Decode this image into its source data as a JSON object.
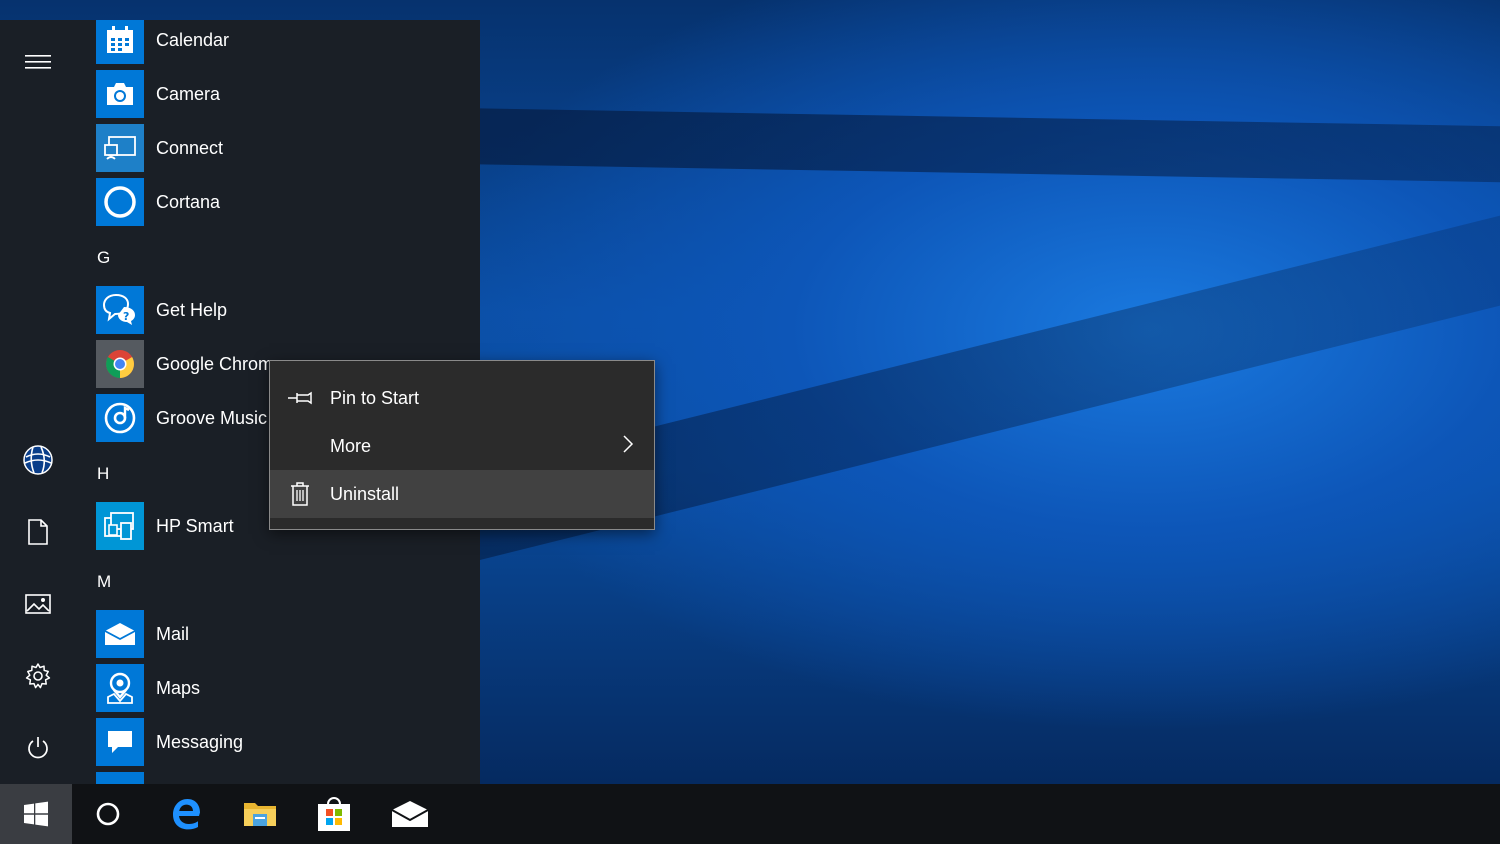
{
  "start_menu": {
    "rail": {
      "items": [
        {
          "name": "expand",
          "icon": "hamburger-icon"
        },
        {
          "name": "account",
          "icon": "user-avatar"
        },
        {
          "name": "documents",
          "icon": "document-icon"
        },
        {
          "name": "pictures",
          "icon": "pictures-icon"
        },
        {
          "name": "settings",
          "icon": "gear-icon"
        },
        {
          "name": "power",
          "icon": "power-icon"
        }
      ]
    },
    "app_list": {
      "apps": [
        {
          "label": "Calendar",
          "icon": "calendar-icon"
        },
        {
          "label": "Camera",
          "icon": "camera-icon"
        },
        {
          "label": "Connect",
          "icon": "connect-icon"
        },
        {
          "label": "Cortana",
          "icon": "cortana-icon"
        },
        {
          "label": "Get Help",
          "icon": "get-help-icon"
        },
        {
          "label": "Google Chrome",
          "icon": "chrome-icon"
        },
        {
          "label": "Groove Music",
          "icon": "groove-music-icon"
        },
        {
          "label": "HP Smart",
          "icon": "hp-smart-icon"
        },
        {
          "label": "Mail",
          "icon": "mail-icon"
        },
        {
          "label": "Maps",
          "icon": "maps-icon"
        },
        {
          "label": "Messaging",
          "icon": "messaging-icon"
        }
      ],
      "letters": [
        "G",
        "H",
        "M"
      ]
    }
  },
  "context_menu": {
    "items": [
      {
        "label": "Pin to Start",
        "icon": "pin-icon"
      },
      {
        "label": "More",
        "icon": "chevron-right-icon"
      },
      {
        "label": "Uninstall",
        "icon": "trash-icon"
      }
    ]
  },
  "taskbar": {
    "items": [
      {
        "name": "start",
        "icon": "windows-logo-icon"
      },
      {
        "name": "cortana",
        "icon": "cortana-circle-icon"
      },
      {
        "name": "edge",
        "icon": "edge-icon"
      },
      {
        "name": "file-explorer",
        "icon": "folder-icon"
      },
      {
        "name": "store",
        "icon": "store-icon"
      },
      {
        "name": "mail",
        "icon": "mail-icon"
      }
    ]
  },
  "colors": {
    "accent": "#0078d7",
    "start_bg": "#1a1f26",
    "taskbar_bg": "#101215",
    "menu_bg": "#2b2b2b"
  }
}
